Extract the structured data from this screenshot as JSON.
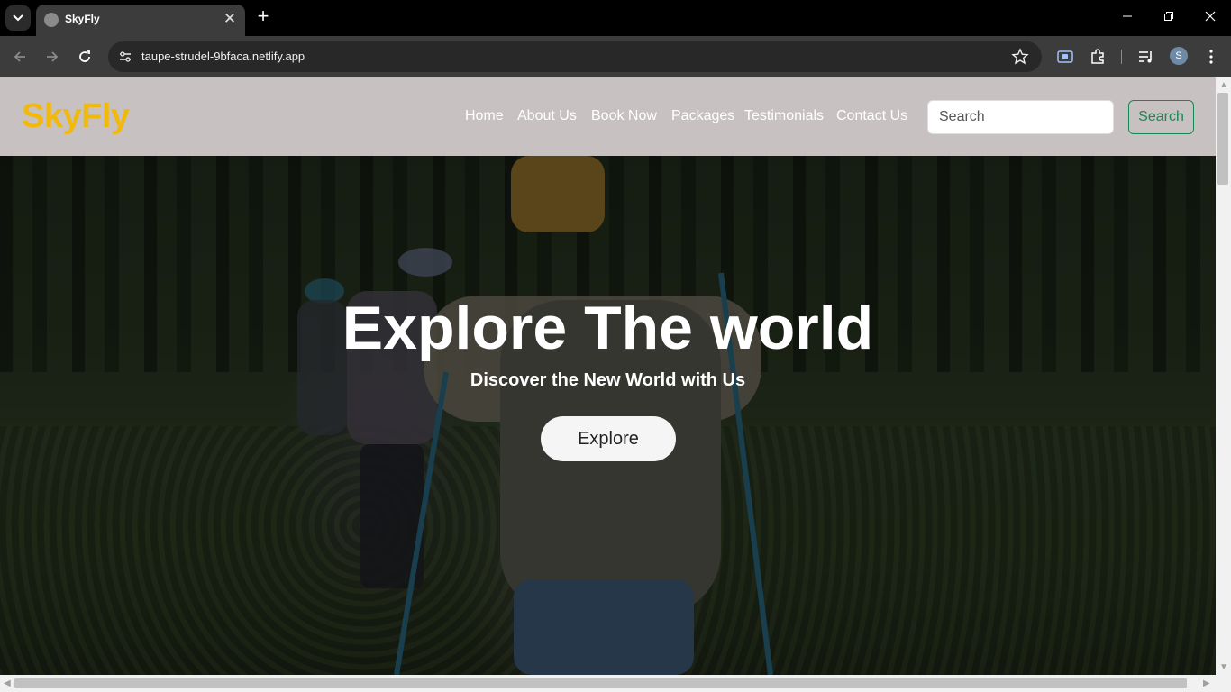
{
  "browser": {
    "tab_title": "SkyFly",
    "new_tab_symbol": "+",
    "tab_close_symbol": "✕",
    "url": "taupe-strudel-9bfaca.netlify.app",
    "profile_initial": "S",
    "icons": [
      "tab-list-icon",
      "favicon-icon",
      "close-icon",
      "new-tab-icon",
      "back-icon",
      "forward-icon",
      "reload-icon",
      "site-info-icon",
      "star-icon",
      "screen-share-icon",
      "extensions-icon",
      "media-icon",
      "menu-icon",
      "minimize-icon",
      "restore-icon",
      "window-close-icon"
    ]
  },
  "navbar": {
    "brand": "SkyFly",
    "links": [
      "Home",
      "About Us",
      "Book Now",
      "Packages",
      "Testimonials",
      "Contact Us"
    ],
    "search_placeholder": "Search",
    "search_button": "Search"
  },
  "hero": {
    "title": "Explore The world",
    "subtitle": "Discover the New World with Us",
    "button": "Explore"
  },
  "colors": {
    "brand": "#f2b90d",
    "navbar_bg": "#c8c1c1",
    "search_accent": "#198754"
  }
}
